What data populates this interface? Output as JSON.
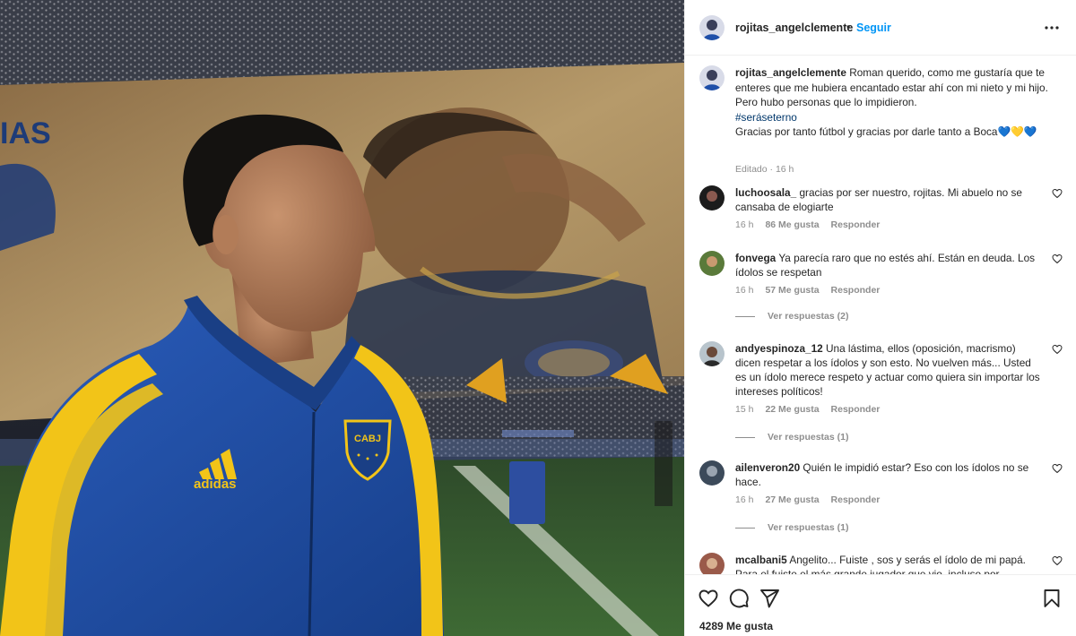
{
  "post": {
    "image_alt": "Photo of a man in a blue and yellow CABJ adidas jacket in front of a giant banner",
    "jacket_brand": "adidas",
    "jacket_badge": "CABJ",
    "banner_text_fragment": "IAS",
    "colors": {
      "jacket_blue": "#1f4fa8",
      "jacket_yellow": "#f2c418",
      "banner": "#a7895a",
      "pitch": "#2f5a2a"
    }
  },
  "header": {
    "username": "rojitas_angelclemente",
    "separator": "•",
    "follow_label": "Seguir",
    "more_icon": "more-horizontal-icon"
  },
  "caption": {
    "username": "rojitas_angelclemente",
    "text_line1": "Roman querido, como me gustaría que te enteres que me hubiera encantado estar ahí con mi nieto y mi hijo. Pero hubo personas que lo impidieron.",
    "hashtag": "#seráseterno",
    "text_line2": "Gracias por tanto fútbol y gracias por darle tanto a Boca💙💛💙",
    "meta": "Editado · 16 h"
  },
  "comments": [
    {
      "username": "luchoosala_",
      "text": "gracias por ser nuestro, rojitas. Mi abuelo no se cansaba de elogiarte",
      "time": "16 h",
      "likes": "86 Me gusta",
      "reply_label": "Responder",
      "replies": ""
    },
    {
      "username": "fonvega",
      "text": "Ya parecía raro que no estés ahí. Están en deuda. Los ídolos se respetan",
      "time": "16 h",
      "likes": "57 Me gusta",
      "reply_label": "Responder",
      "replies": "Ver respuestas (2)"
    },
    {
      "username": "andyespinoza_12",
      "text": "Una lástima, ellos (oposición, macrismo) dicen respetar a los ídolos y son esto. No vuelven más... Usted es un ídolo merece respeto y actuar como quiera sin importar los intereses políticos!",
      "time": "15 h",
      "likes": "22 Me gusta",
      "reply_label": "Responder",
      "replies": "Ver respuestas (1)"
    },
    {
      "username": "ailenveron20",
      "text": "Quién le impidió estar? Eso con los ídolos no se hace.",
      "time": "16 h",
      "likes": "27 Me gusta",
      "reply_label": "Responder",
      "replies": "Ver respuestas (1)"
    },
    {
      "username": "mcalbani5",
      "text": "Angelito... Fuiste , sos y serás el ídolo de mi papá. Para el fuiste el más grande jugador que vio, incluso por",
      "time": "",
      "likes": "",
      "reply_label": "",
      "replies": ""
    }
  ],
  "actions": {
    "like_icon": "heart-icon",
    "comment_icon": "comment-icon",
    "share_icon": "send-icon",
    "save_icon": "bookmark-icon",
    "likes_count": "4289 Me gusta"
  }
}
